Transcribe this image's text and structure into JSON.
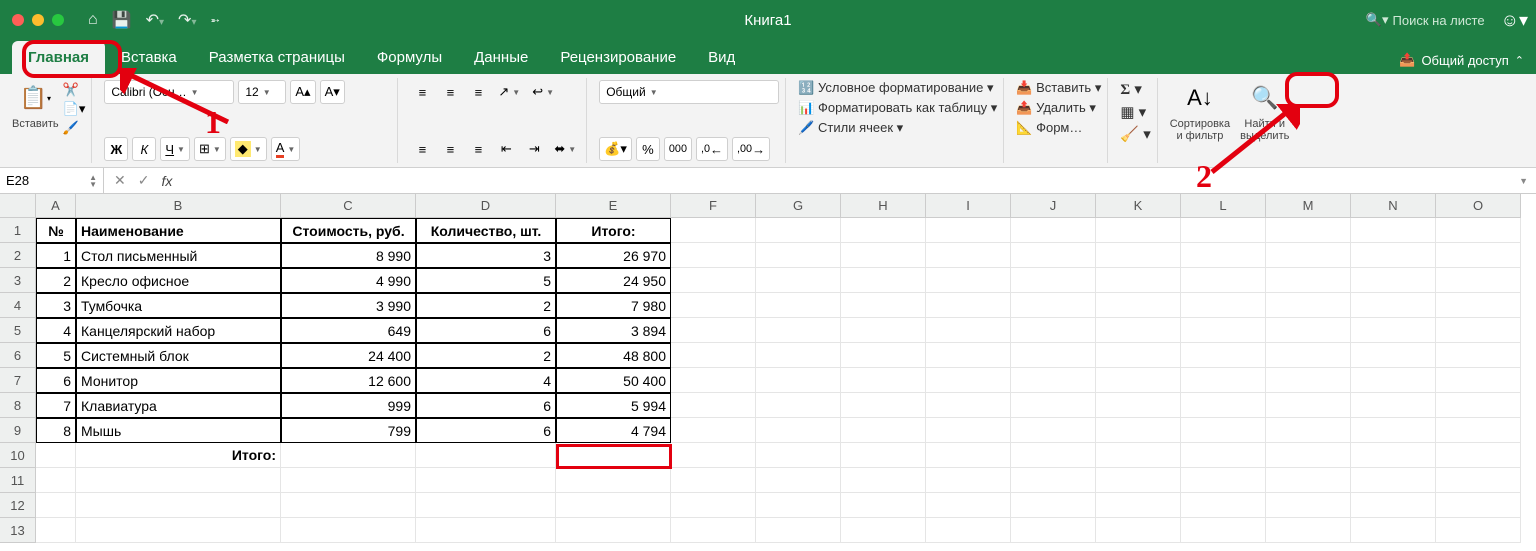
{
  "titlebar": {
    "title": "Книга1",
    "search_placeholder": "Поиск на листе"
  },
  "tabs": {
    "home": "Главная",
    "insert": "Вставка",
    "layout": "Разметка страницы",
    "formulas": "Формулы",
    "data": "Данные",
    "review": "Рецензирование",
    "view": "Вид",
    "share": "Общий доступ"
  },
  "ribbon": {
    "paste": "Вставить",
    "font_name": "Calibri (Осн…",
    "font_size": "12",
    "number_format": "Общий",
    "cond_fmt": "Условное форматирование",
    "fmt_table": "Форматировать как таблицу",
    "cell_styles": "Стили ячеек",
    "insert_btn": "Вставить",
    "delete_btn": "Удалить",
    "format_btn": "Форм…",
    "sort_filter": "Сортировка\nи фильтр",
    "find_select": "Найти и\nвыделить"
  },
  "formula_bar": {
    "cell_ref": "E28"
  },
  "columns": {
    "A": 40,
    "B": 205,
    "C": 135,
    "D": 140,
    "E": 115,
    "F": 85,
    "G": 85,
    "H": 85,
    "I": 85,
    "J": 85,
    "K": 85,
    "L": 85,
    "M": 85,
    "N": 85,
    "O": 85
  },
  "table": {
    "headers": {
      "n": "№",
      "name": "Наименование",
      "cost": "Стоимость, руб.",
      "qty": "Количество, шт.",
      "total": "Итого:"
    },
    "rows": [
      {
        "n": "1",
        "name": "Стол письменный",
        "cost": "8 990",
        "qty": "3",
        "total": "26 970"
      },
      {
        "n": "2",
        "name": "Кресло офисное",
        "cost": "4 990",
        "qty": "5",
        "total": "24 950"
      },
      {
        "n": "3",
        "name": "Тумбочка",
        "cost": "3 990",
        "qty": "2",
        "total": "7 980"
      },
      {
        "n": "4",
        "name": "Канцелярский набор",
        "cost": "649",
        "qty": "6",
        "total": "3 894"
      },
      {
        "n": "5",
        "name": "Системный блок",
        "cost": "24 400",
        "qty": "2",
        "total": "48 800"
      },
      {
        "n": "6",
        "name": "Монитор",
        "cost": "12 600",
        "qty": "4",
        "total": "50 400"
      },
      {
        "n": "7",
        "name": "Клавиатура",
        "cost": "999",
        "qty": "6",
        "total": "5 994"
      },
      {
        "n": "8",
        "name": "Мышь",
        "cost": "799",
        "qty": "6",
        "total": "4 794"
      }
    ],
    "footer_label": "Итого:"
  },
  "annotations": {
    "one": "1",
    "two": "2"
  }
}
